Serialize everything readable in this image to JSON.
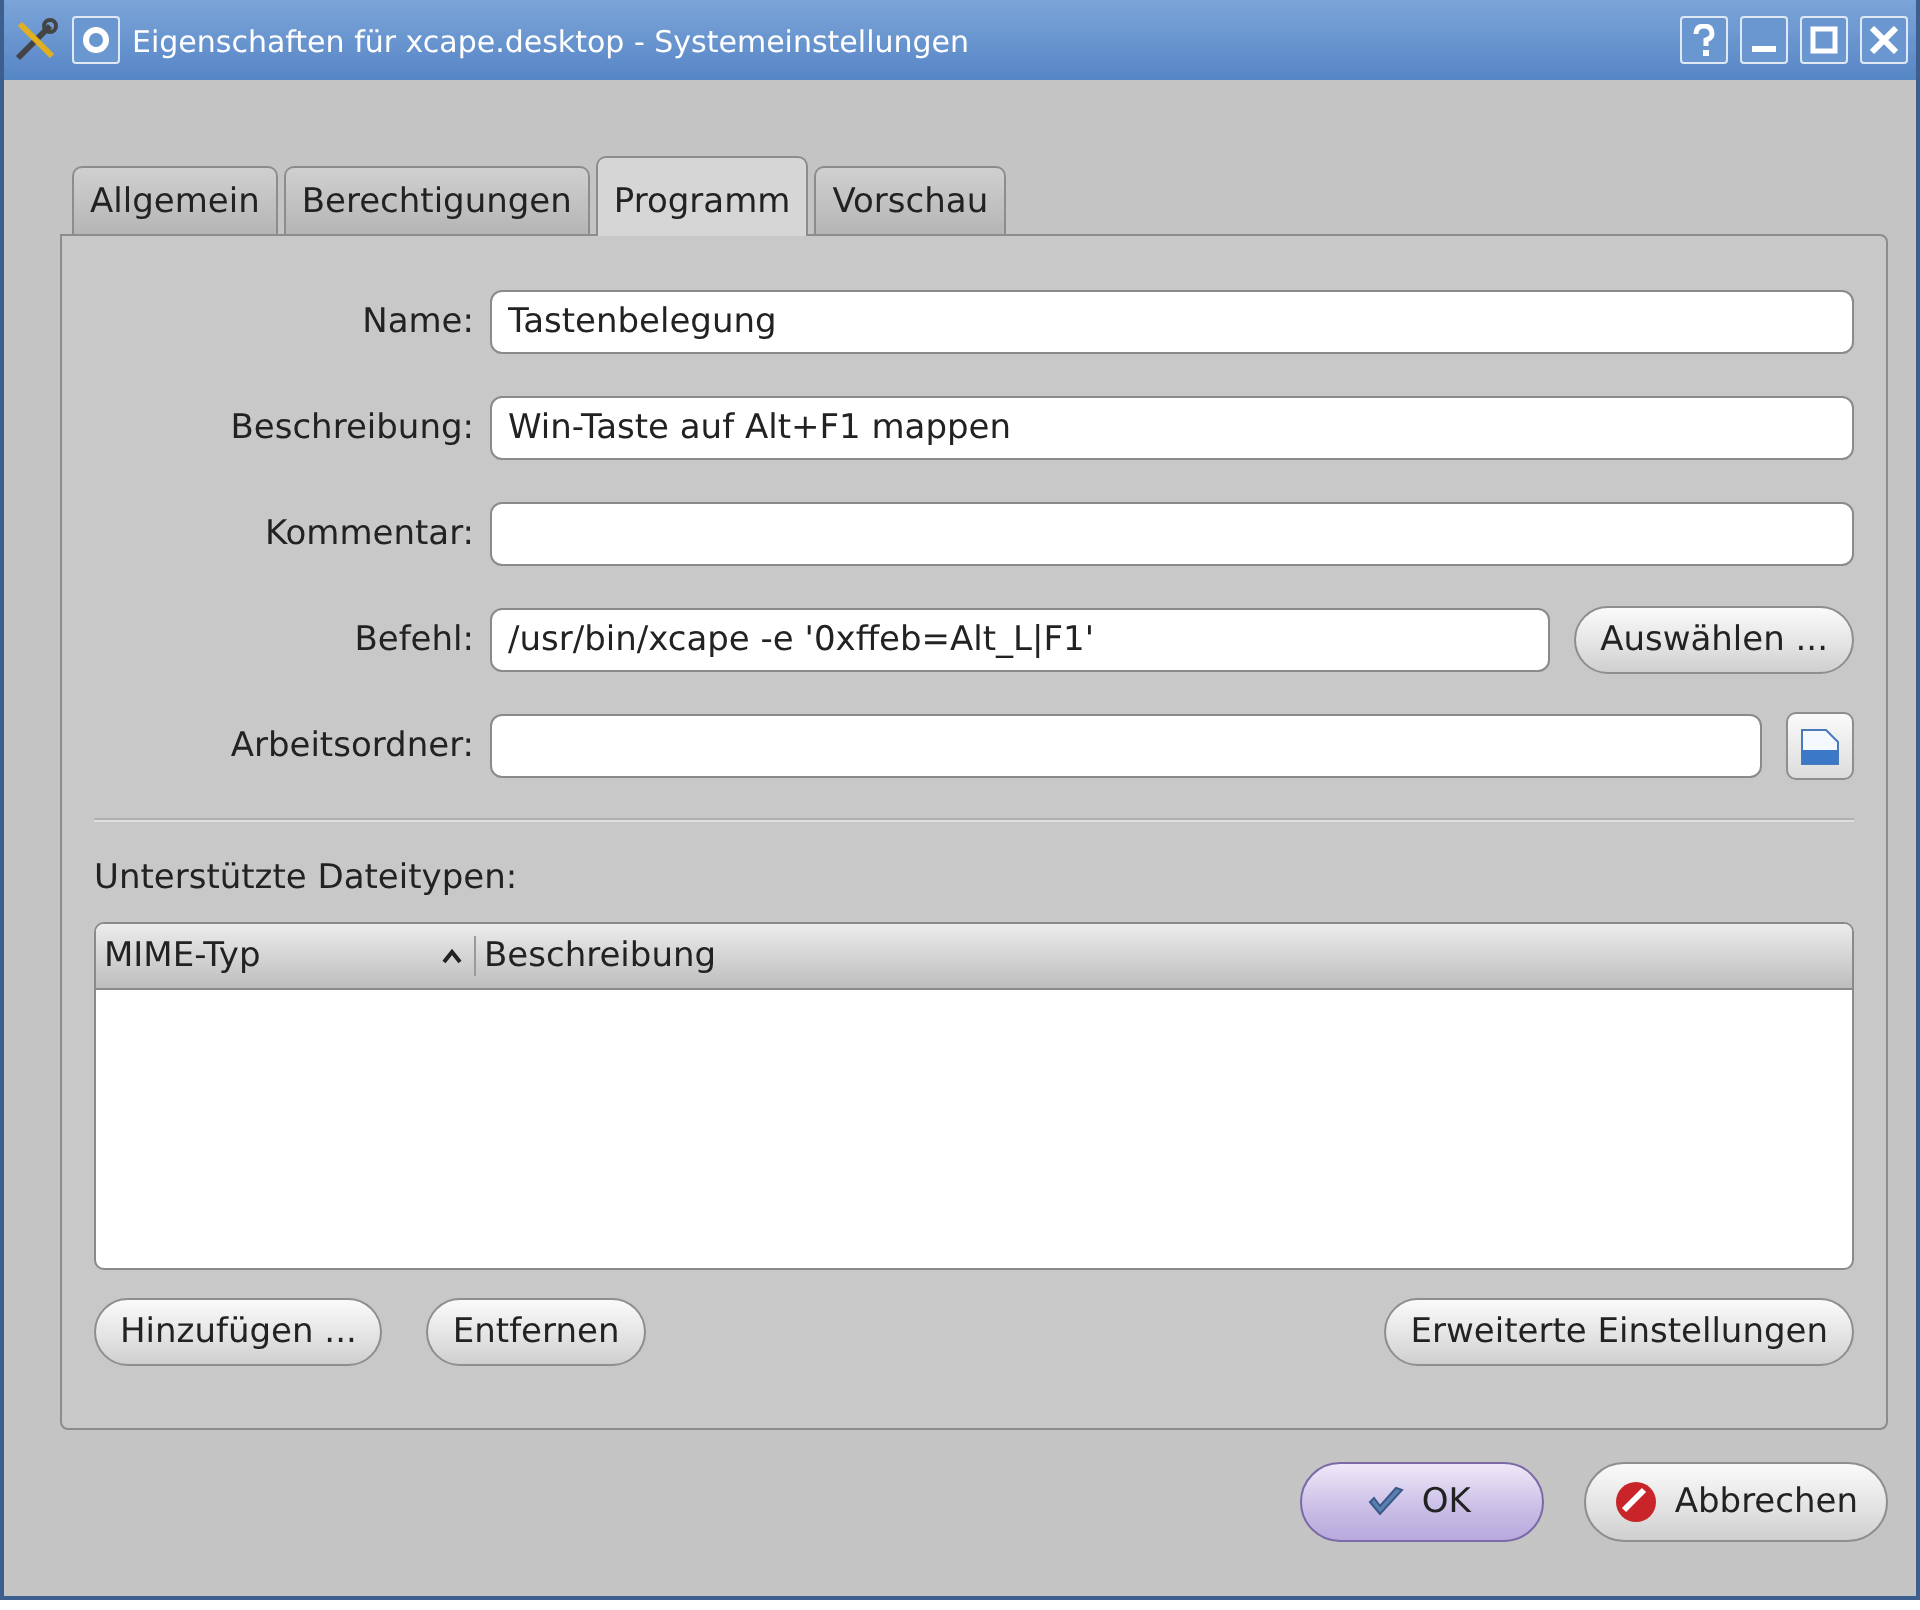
{
  "window": {
    "title": "Eigenschaften für xcape.desktop - Systemeinstellungen"
  },
  "tabs": [
    {
      "label": "Allgemein",
      "selected": false
    },
    {
      "label": "Berechtigungen",
      "selected": false
    },
    {
      "label": "Programm",
      "selected": true
    },
    {
      "label": "Vorschau",
      "selected": false
    }
  ],
  "form": [
    {
      "label": "Name:",
      "value": "Tastenbelegung",
      "kind": "text"
    },
    {
      "label": "Beschreibung:",
      "value": "Win-Taste auf Alt+F1 mappen",
      "kind": "text"
    },
    {
      "label": "Kommentar:",
      "kind": "text"
    },
    {
      "label": "Befehl:",
      "value": "/usr/bin/xcape -e '0xffeb=Alt_L|F1'",
      "kind": "command",
      "button": "Auswählen ..."
    },
    {
      "label": "Arbeitsordner:",
      "kind": "folder"
    }
  ],
  "file_types": {
    "label": "Unterstützte Dateitypen:",
    "columns": [
      {
        "label": "MIME-Typ",
        "sorted": true
      },
      {
        "label": "Beschreibung",
        "sorted": false
      }
    ],
    "buttons": [
      "Hinzufügen ...",
      "Entfernen"
    ],
    "advanced_button": "Erweiterte Einstellungen"
  },
  "dialog_buttons": [
    {
      "label": "OK",
      "kind": "ok",
      "default": true
    },
    {
      "label": "Abbrechen",
      "kind": "cancel",
      "default": false
    }
  ]
}
